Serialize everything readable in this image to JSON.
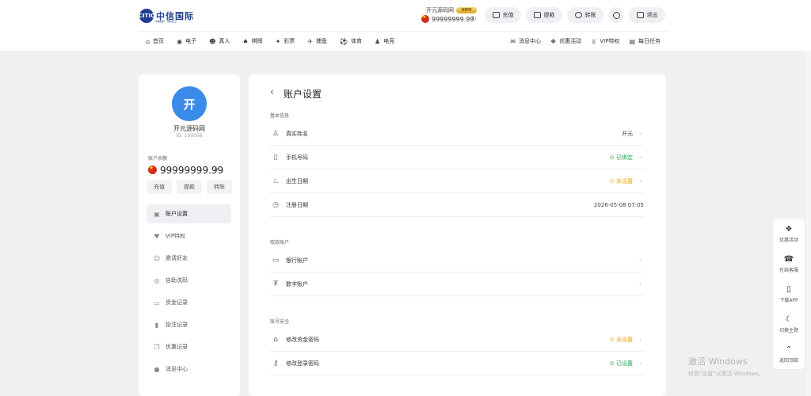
{
  "header": {
    "logo": {
      "mark": "CITIC",
      "text": "中信国际",
      "sub": "中信国际 · 信誉至上"
    },
    "user": {
      "name": "开元源码网",
      "vip": "VIP0",
      "balance": "99999999.99",
      "refresh_icon": "refresh-icon"
    },
    "buttons": [
      {
        "label": "充值",
        "icon": "wallet-icon"
      },
      {
        "label": "提款",
        "icon": "card-icon"
      },
      {
        "label": "转账",
        "icon": "transfer-icon"
      },
      {
        "label": "退出",
        "icon": "logout-icon"
      }
    ],
    "nav_left": [
      {
        "label": "首页",
        "icon": "⌂"
      },
      {
        "label": "电子",
        "icon": "◉"
      },
      {
        "label": "真人",
        "icon": "☻"
      },
      {
        "label": "棋牌",
        "icon": "♠"
      },
      {
        "label": "彩票",
        "icon": "✦"
      },
      {
        "label": "捕鱼",
        "icon": "✈"
      },
      {
        "label": "体育",
        "icon": "⚽"
      },
      {
        "label": "电竞",
        "icon": "♟"
      }
    ],
    "nav_right": [
      {
        "label": "消息中心",
        "icon": "✉"
      },
      {
        "label": "优惠活动",
        "icon": "❖"
      },
      {
        "label": "VIP特权",
        "icon": "♕"
      },
      {
        "label": "每日任务",
        "icon": "▤"
      }
    ]
  },
  "sidebar": {
    "avatar_char": "开",
    "name": "开元源码网",
    "id_text": "ID: 100056",
    "balance_label": "账户余额",
    "balance": "99999999.99",
    "buttons": [
      "充值",
      "提款",
      "转账"
    ],
    "menu": [
      {
        "label": "账户设置",
        "icon": "▣",
        "active": true
      },
      {
        "label": "VIP特权",
        "icon": "♥"
      },
      {
        "label": "邀请好友",
        "icon": "☺"
      },
      {
        "label": "自助洗码",
        "icon": "◎"
      },
      {
        "label": "资金记录",
        "icon": "▭"
      },
      {
        "label": "投注记录",
        "icon": "▮"
      },
      {
        "label": "优惠记录",
        "icon": "❒"
      },
      {
        "label": "消息中心",
        "icon": "●"
      }
    ]
  },
  "main": {
    "back_icon": "‹",
    "title": "账户设置",
    "sections": {
      "basic": "基本信息",
      "withdraw": "取款账户",
      "security": "账号安全"
    },
    "rows": {
      "real_name": {
        "label": "真实姓名",
        "value": "开元",
        "icon": "user-icon"
      },
      "phone": {
        "label": "手机号码",
        "value": "已绑定",
        "icon": "phone-icon"
      },
      "birthday": {
        "label": "出生日期",
        "value": "未设置",
        "icon": "cake-icon"
      },
      "register": {
        "label": "注册日期",
        "value": "2026-05-08 07:05",
        "icon": "clock-icon"
      },
      "bank": {
        "label": "银行账户",
        "value": "",
        "icon": "bank-card-icon"
      },
      "crypto": {
        "label": "数字账户",
        "value": "",
        "icon": "crypto-icon"
      },
      "fund_pwd": {
        "label": "修改资金密码",
        "value": "未设置",
        "icon": "lock-icon"
      },
      "login_pwd": {
        "label": "修改登录密码",
        "value": "已设置",
        "icon": "key-icon"
      }
    }
  },
  "float_bar": [
    {
      "label": "优惠活动",
      "icon": "❖"
    },
    {
      "label": "在线客服",
      "icon": "☎"
    },
    {
      "label": "下载APP",
      "icon": "▯"
    },
    {
      "label": "切换主题",
      "icon": "☾"
    },
    {
      "label": "返回顶部",
      "icon": "⌃"
    }
  ],
  "watermark": {
    "line1": "激活 Windows",
    "line2": "转到\"设置\"以激活 Windows。"
  },
  "colors": {
    "accent_blue": "#3b8beb",
    "green": "#2aa34a",
    "orange": "#f0a21b",
    "flag_red": "#d52b1e"
  }
}
